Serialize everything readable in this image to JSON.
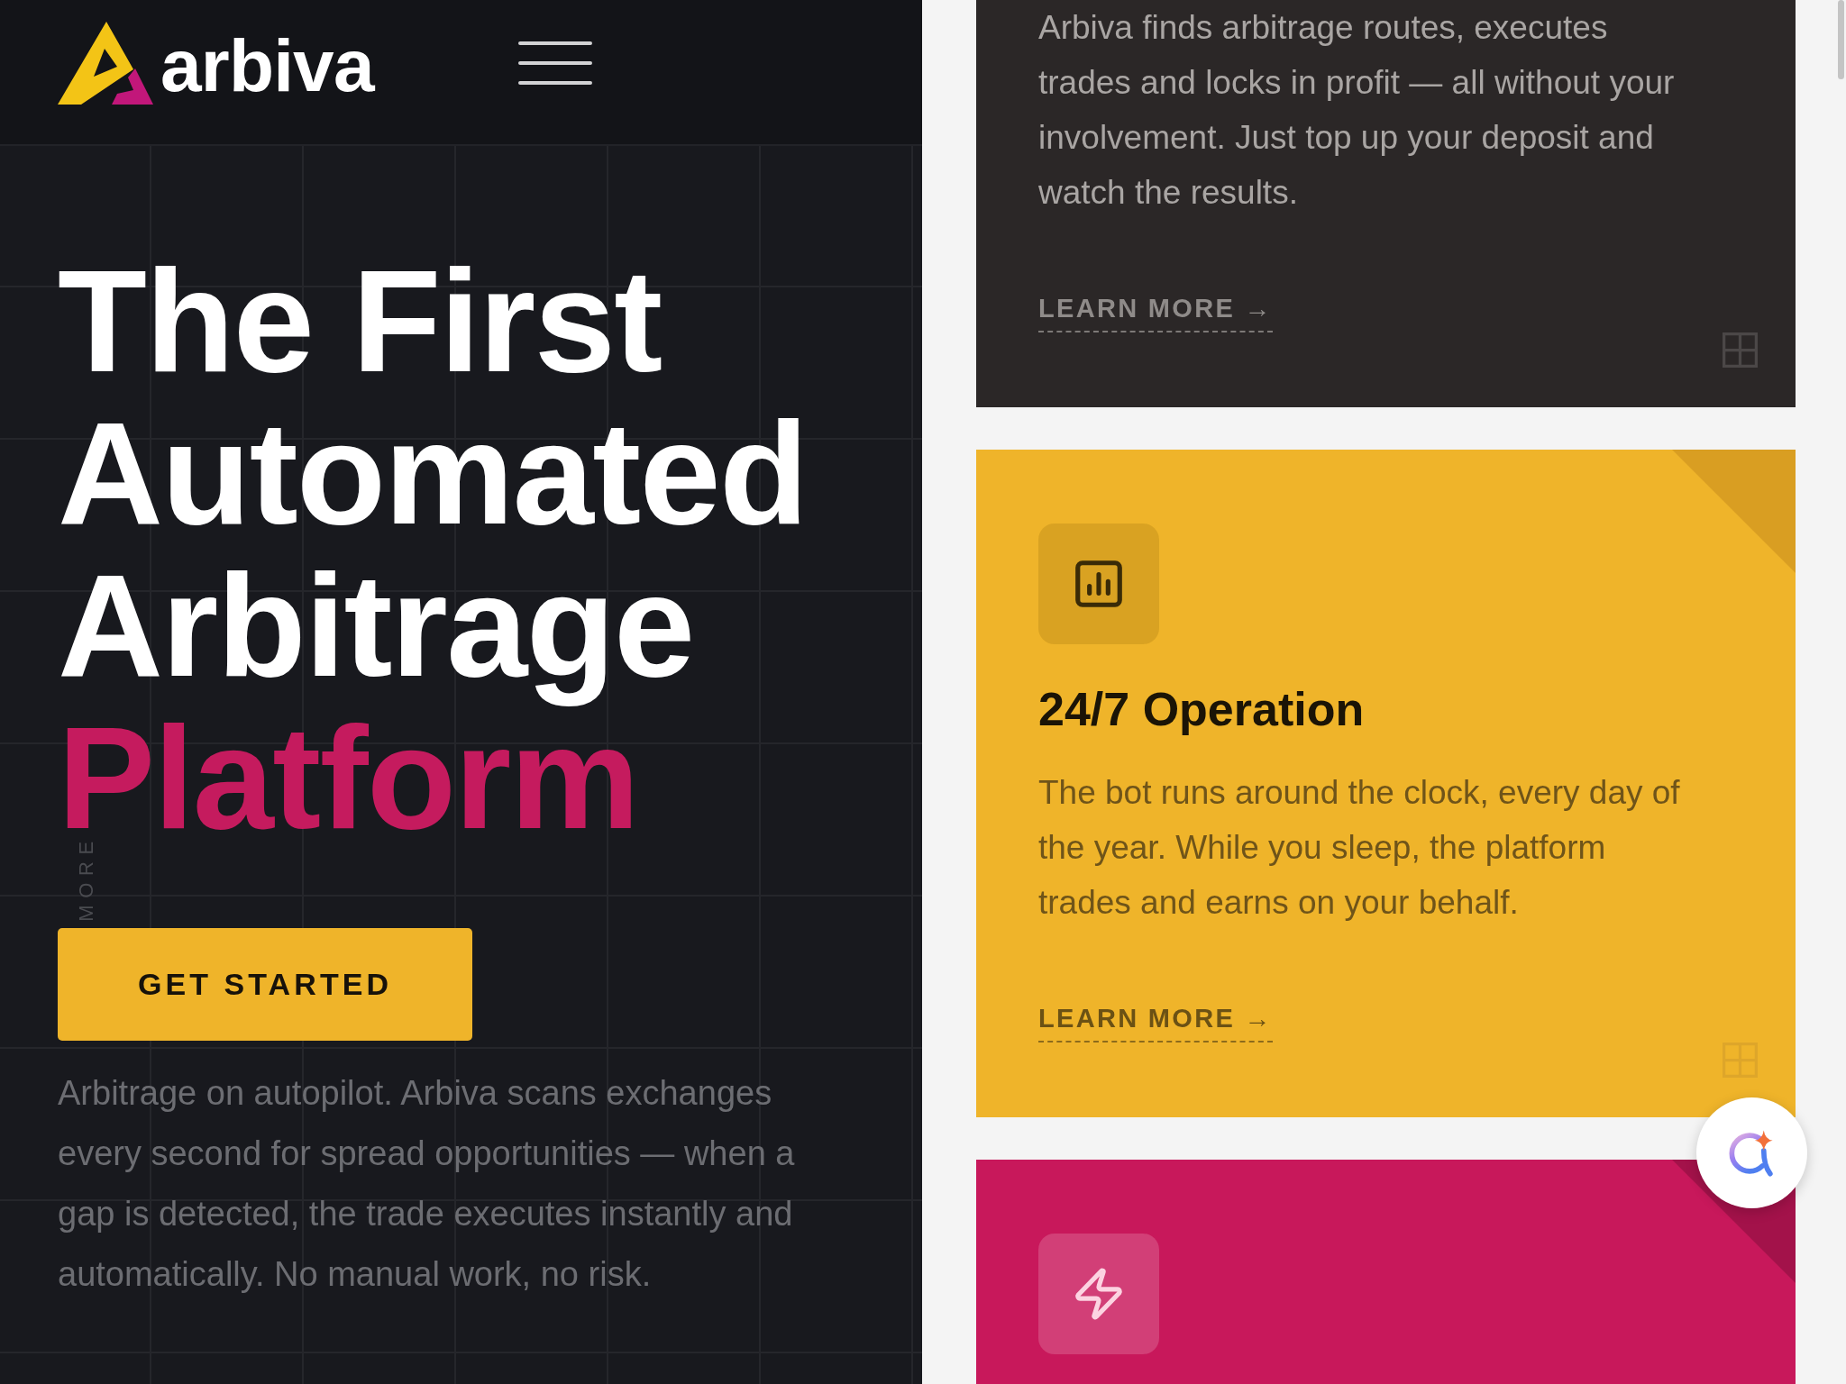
{
  "header": {
    "logo_text": "arbiva"
  },
  "hero": {
    "title_lines": [
      {
        "text": "The First",
        "color": "#ffffff"
      },
      {
        "text": "Automated",
        "color": "#ffffff"
      },
      {
        "text": "Arbitrage",
        "color": "#ffffff"
      },
      {
        "text": "Platform",
        "color": "#c51b5e"
      }
    ],
    "side_label": "MORE",
    "cta_button": "GET STARTED",
    "description": "Arbitrage on autopilot. Arbiva scans exchanges every second for spread opportunities — when a gap is detected, the trade executes instantly and automatically. No manual work, no risk."
  },
  "feature_cards": [
    {
      "color": "#2b2727",
      "description": "Arbiva finds arbitrage routes, executes trades and locks in profit — all without your involvement. Just top up your deposit and watch the results.",
      "link": "LEARN MORE →"
    },
    {
      "color": "#efb42a",
      "title": "24/7 Operation",
      "description": "The bot runs around the clock, every day of the year. While you sleep, the platform trades and earns on your behalf.",
      "link": "LEARN MORE →"
    },
    {
      "color": "#c8185b"
    }
  ]
}
